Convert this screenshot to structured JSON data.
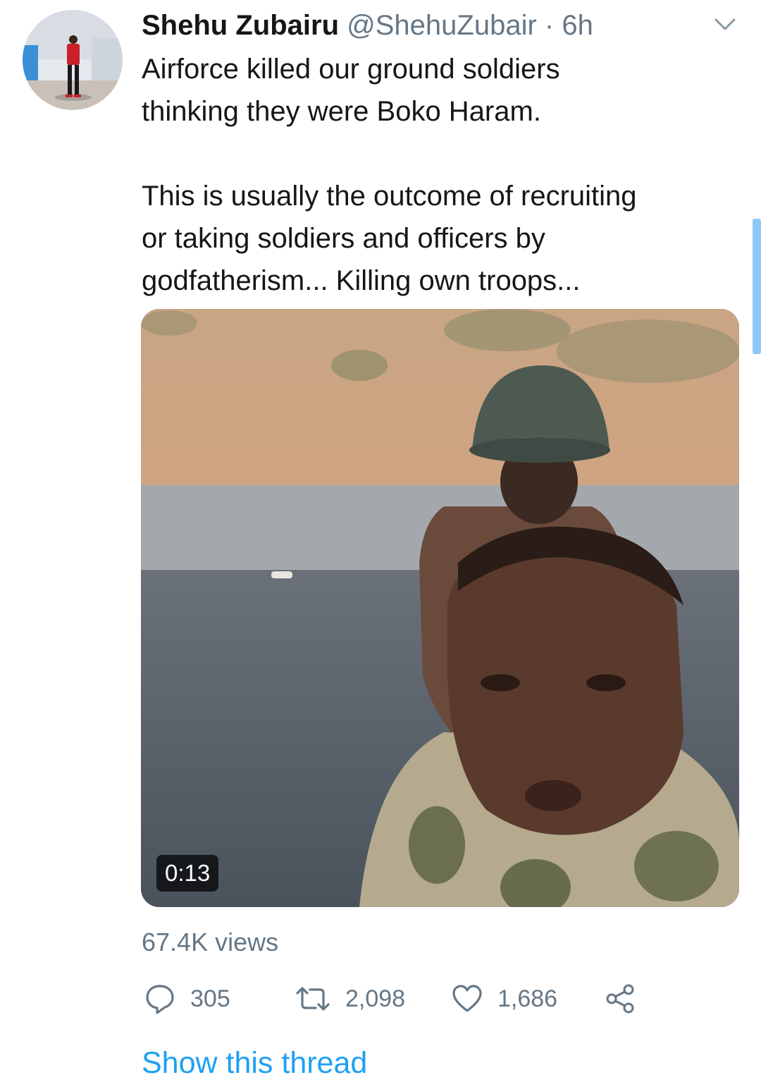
{
  "tweet": {
    "author_name": "Shehu Zubairu",
    "author_handle": "@ShehuZubair",
    "separator": "·",
    "time": "6h",
    "text": "Airforce killed our ground soldiers\nthinking they were Boko Haram.\n\nThis is usually the outcome of recruiting\nor taking soldiers and officers by\ngodfatherism... Killing own troops...",
    "video_duration": "0:13",
    "views": "67.4K views",
    "replies": "305",
    "retweets": "2,098",
    "likes": "1,686",
    "show_thread": "Show this thread"
  },
  "icons": {
    "menu": "chevron-down-icon",
    "reply": "reply-icon",
    "retweet": "retweet-icon",
    "like": "heart-icon",
    "share": "share-icon"
  },
  "colors": {
    "text": "#14171a",
    "secondary": "#657786",
    "accent": "#1da1f2",
    "scrollbar": "#8ec8f2"
  }
}
